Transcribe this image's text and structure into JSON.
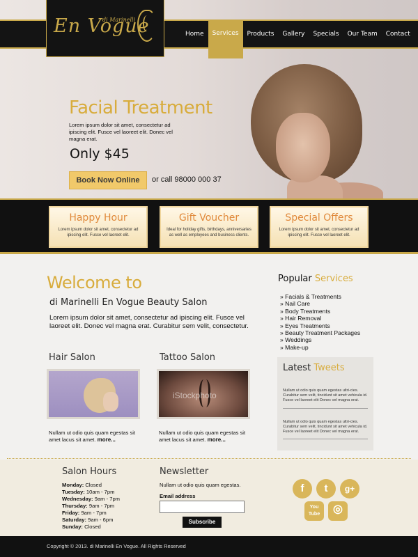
{
  "header": {
    "logo_text": "En Vogue",
    "logo_small": "di Marinelli",
    "nav": [
      "Home",
      "Services",
      "Products",
      "Gallery",
      "Specials",
      "Our Team",
      "Contact"
    ],
    "active_nav": "Services"
  },
  "hero": {
    "title": "Facial Treatment",
    "description": "Lorem ipsum dolor sit amet, consectetur ad ipiscing elit. Fusce vel laoreet elit. Donec vel magna erat.",
    "price": "Only $45",
    "book_button": "Book Now Online",
    "call_text": "or call 98000 000 37"
  },
  "features": [
    {
      "title": "Happy Hour",
      "text": "Lorem ipsum dolor sit amet, consectetur ad ipiscing elit. Fusce vel laoreet elit."
    },
    {
      "title": "Gift Voucher",
      "text": "Ideal for holiday gifts, birthdays, anniversaries as well as employees and business clients."
    },
    {
      "title": "Special Offers",
      "text": "Lorem ipsum dolor sit amet, consectetur ad ipiscing elit. Fusce vel laoreet elit."
    }
  ],
  "welcome": {
    "title": "Welcome to",
    "subtitle": "di Marinelli En Vogue Beauty Salon",
    "text": "Lorem ipsum dolor sit amet, consectetur ad ipiscing elit. Fusce vel laoreet elit. Donec vel magna erat. Curabitur sem velit, consectetur."
  },
  "columns": [
    {
      "title": "Hair Salon",
      "text": "Nullam ut odio quis quam egestas  sit amet lacus sit amet.",
      "more": "more..."
    },
    {
      "title": "Tattoo Salon",
      "text": "Nullam ut odio quis quam egestas  sit amet lacus sit amet.",
      "more": "more...",
      "watermark": "iStockphoto"
    }
  ],
  "popular": {
    "title_a": "Popular",
    "title_b": "Services",
    "items": [
      "» Facials & Treatments",
      "» Nail Care",
      "» Body Treatments",
      "» Hair Removal",
      "» Eyes Treatments",
      "» Beauty Treatment Packages",
      "» Weddings",
      "» Make-up"
    ]
  },
  "tweets": {
    "title_a": "Latest",
    "title_b": "Tweets",
    "items": [
      "Nullam ut odio quis quam egestas ultri-cies. Curabitur sem velit, tincidunt sit amet vehicula id. Fusce vel laoreet elit Donec vel magna erat.",
      "Nullam ut odio quis quam egestas ultri-cies. Curabitur sem velit, tincidunt sit amet vehicula id. Fusce vel laoreet elit Donec vel magna erat."
    ]
  },
  "footer": {
    "hours_title": "Salon Hours",
    "hours": [
      {
        "day": "Monday:",
        "time": "Closed"
      },
      {
        "day": "Tuesday:",
        "time": "10am - 7pm"
      },
      {
        "day": "Wednesday:",
        "time": "9am - 7pm"
      },
      {
        "day": "Thursday:",
        "time": "9am - 7pm"
      },
      {
        "day": "Friday:",
        "time": "9am - 7pm"
      },
      {
        "day": "Saturday:",
        "time": "9am - 6pm"
      },
      {
        "day": "Sunday:",
        "time": "Closed"
      }
    ],
    "newsletter_title": "Newsletter",
    "newsletter_text": "Nullam ut odio quis quam egestas.",
    "email_label": "Email address",
    "email_value": "",
    "subscribe": "Subscribe",
    "social": [
      "f",
      "t",
      "g+",
      "You Tube",
      "◎"
    ],
    "social_icons": [
      "facebook-icon",
      "twitter-icon",
      "google-plus-icon",
      "youtube-icon",
      "instagram-icon"
    ],
    "copyright": "Copyright © 2013. di Marinelli En Vogue. All Rights Reserved"
  },
  "colors": {
    "gold": "#c9a94a",
    "dark": "#111111",
    "cream": "#f1ece0"
  }
}
